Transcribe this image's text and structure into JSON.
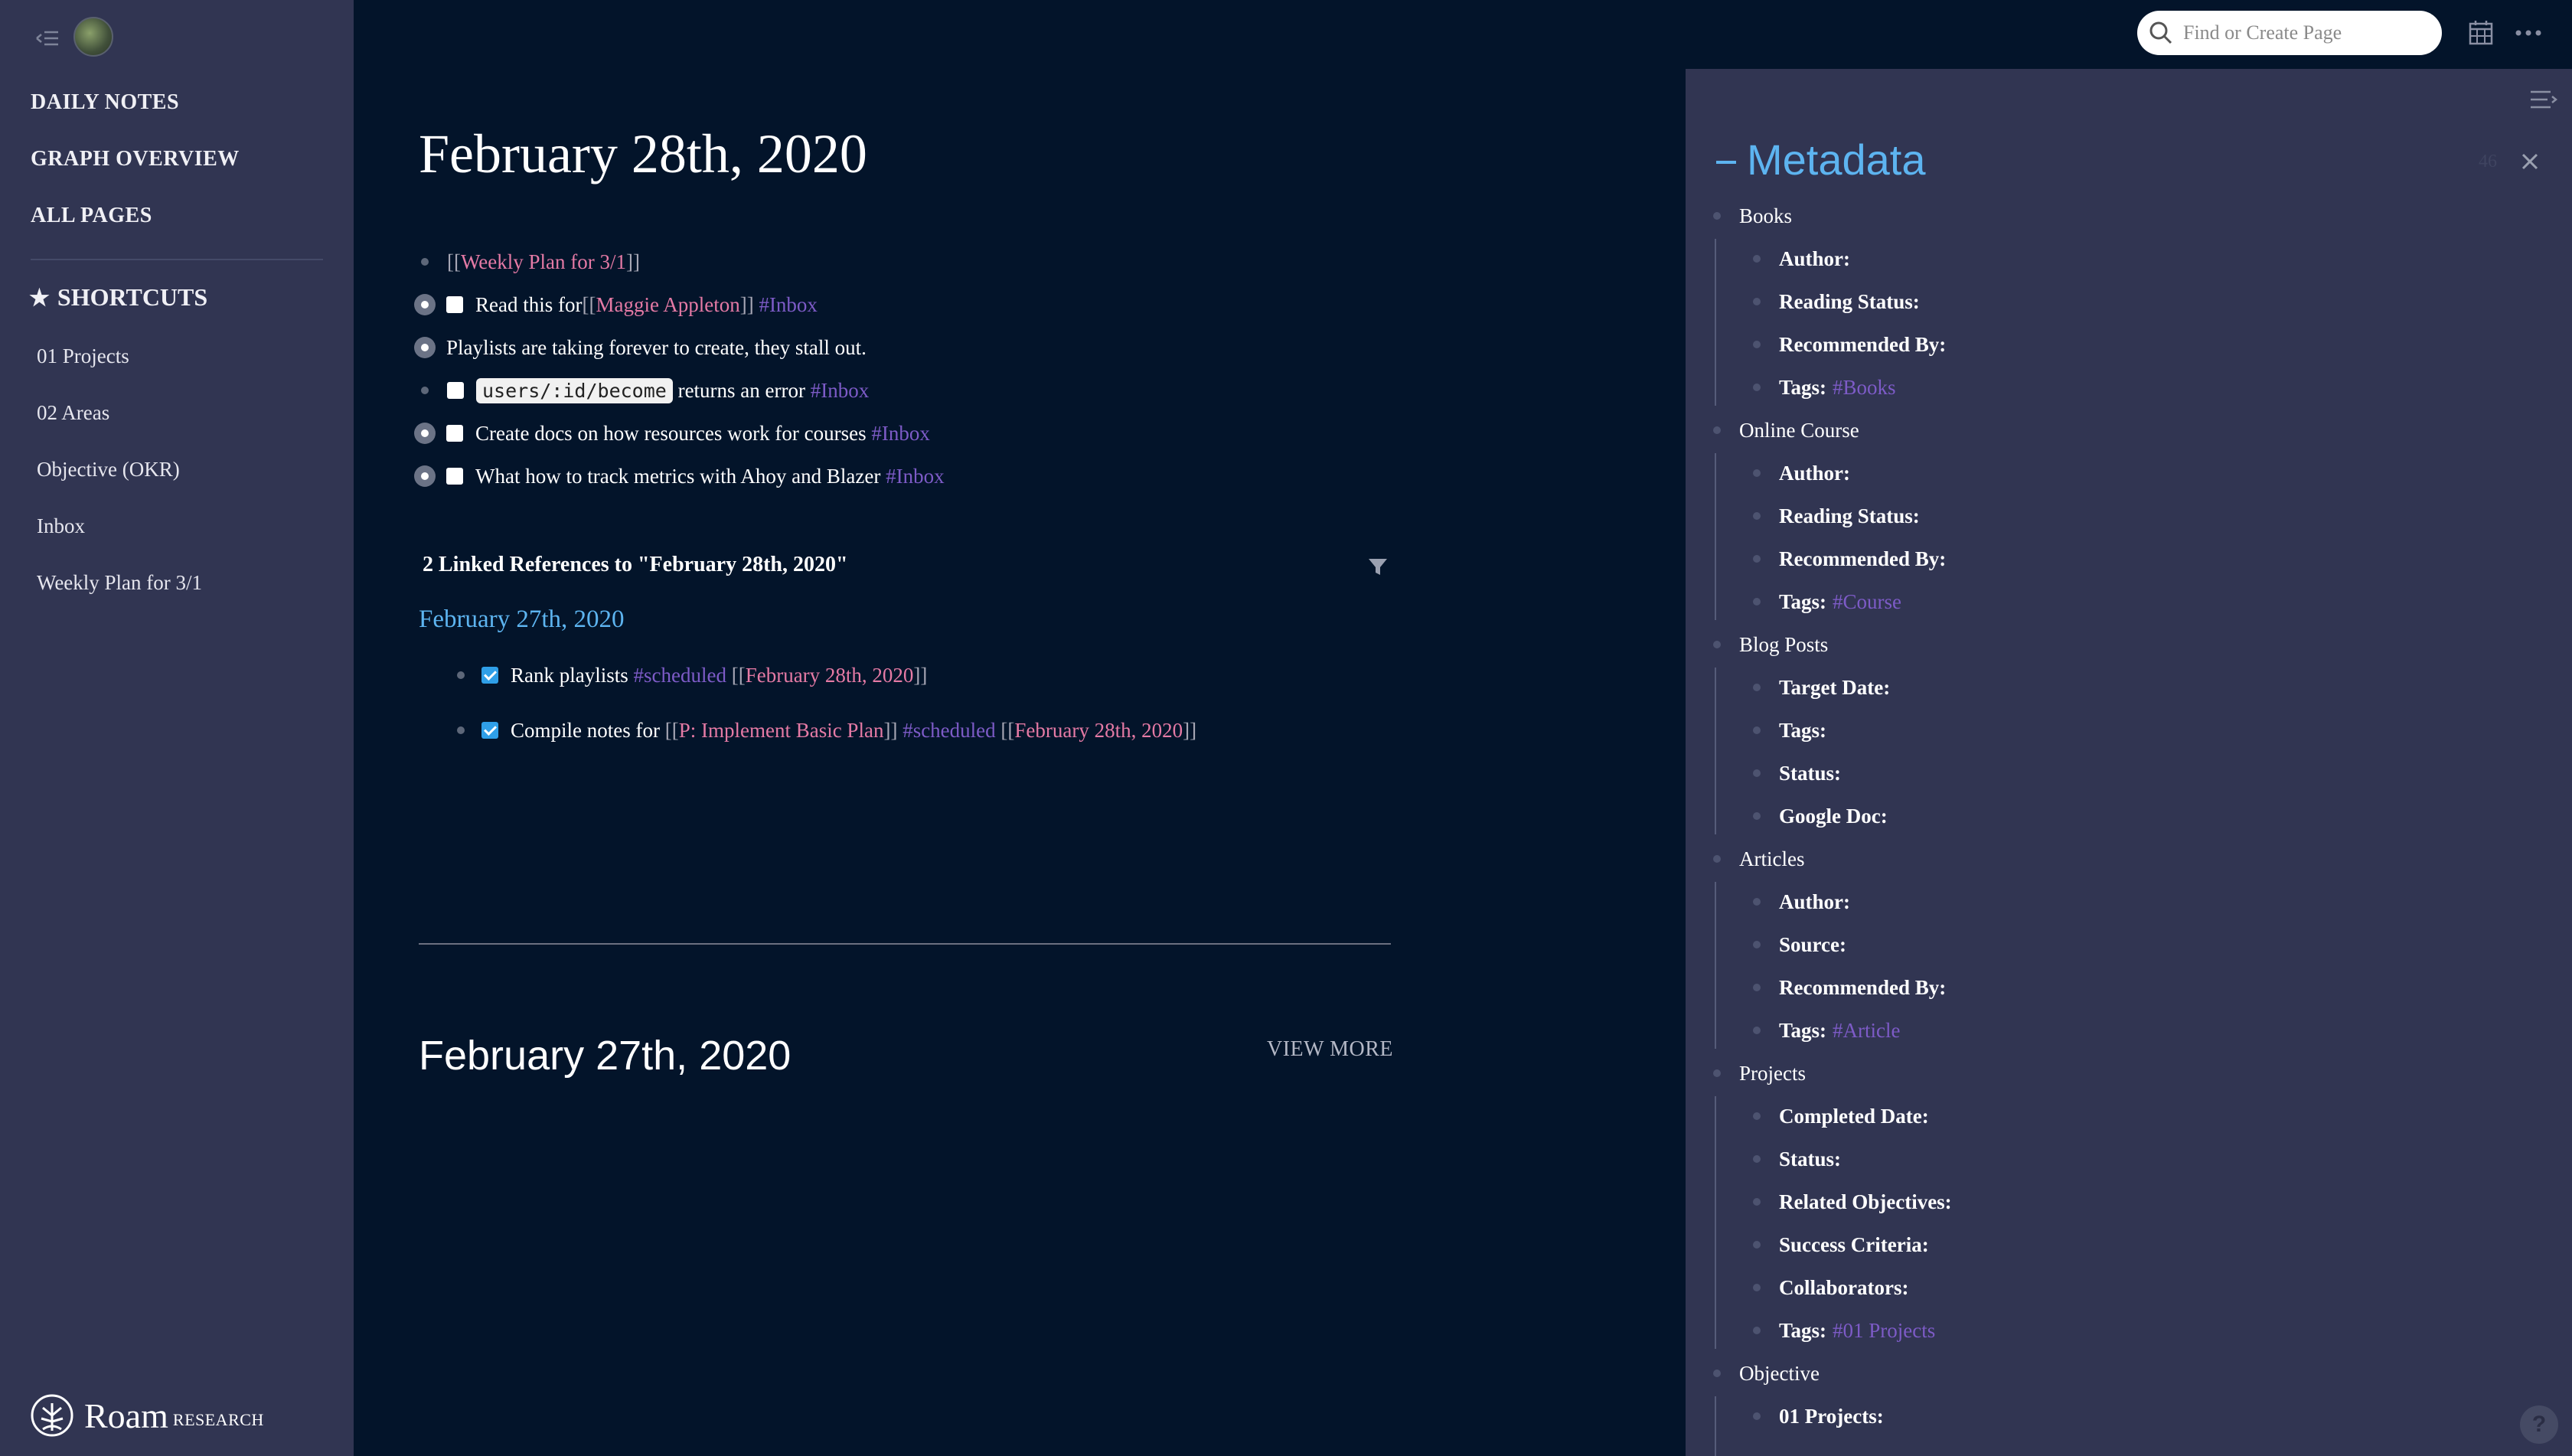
{
  "sidebar": {
    "nav": [
      "DAILY NOTES",
      "GRAPH OVERVIEW",
      "ALL PAGES"
    ],
    "shortcuts_label": "SHORTCUTS",
    "shortcuts": [
      "01 Projects",
      "02 Areas",
      "Objective (OKR)",
      "Inbox",
      "Weekly Plan for 3/1"
    ],
    "logo_word": "Roam",
    "logo_sub": "RESEARCH"
  },
  "topbar": {
    "search_placeholder": "Find or Create Page"
  },
  "main": {
    "title": "February 28th, 2020",
    "blocks": {
      "b1_link": "Weekly Plan for 3/1",
      "b2_text": "Read this for ",
      "b2_link": "Maggie Appleton",
      "b2_tag": "#Inbox",
      "b3_text": "Playlists are taking forever to create, they stall out.",
      "b4_code": "users/:id/become",
      "b4_text": " returns an error ",
      "b4_tag": "#Inbox",
      "b5_text": "Create docs on how resources work for courses ",
      "b5_tag": "#Inbox",
      "b6_text": "What how to track metrics with Ahoy and Blazer ",
      "b6_tag": "#Inbox"
    },
    "linked_refs_heading": "2 Linked References to \"February 28th, 2020\"",
    "ref_page": "February 27th, 2020",
    "refs": {
      "r1_text": "Rank playlists ",
      "r1_tag": "#scheduled",
      "r1_link": "February 28th, 2020",
      "r2_text": "Compile notes for ",
      "r2_link1": "P: Implement Basic Plan",
      "r2_tag": "#scheduled",
      "r2_link2": "February 28th, 2020"
    },
    "second_page_title": "February 27th, 2020",
    "view_more": "VIEW MORE"
  },
  "right_panel": {
    "title": "Metadata",
    "count": "46",
    "sections": [
      {
        "name": "Books",
        "fields": [
          {
            "label": "Author:",
            "tag": ""
          },
          {
            "label": "Reading Status:",
            "tag": ""
          },
          {
            "label": "Recommended By:",
            "tag": ""
          },
          {
            "label": "Tags:",
            "tag": "#Books"
          }
        ]
      },
      {
        "name": "Online Course",
        "fields": [
          {
            "label": "Author:",
            "tag": ""
          },
          {
            "label": "Reading Status:",
            "tag": ""
          },
          {
            "label": "Recommended By:",
            "tag": ""
          },
          {
            "label": "Tags:",
            "tag": "#Course"
          }
        ]
      },
      {
        "name": "Blog Posts",
        "fields": [
          {
            "label": "Target Date:",
            "tag": ""
          },
          {
            "label": "Tags:",
            "tag": ""
          },
          {
            "label": "Status:",
            "tag": ""
          },
          {
            "label": "Google Doc:",
            "tag": ""
          }
        ]
      },
      {
        "name": "Articles",
        "fields": [
          {
            "label": "Author:",
            "tag": ""
          },
          {
            "label": "Source:",
            "tag": ""
          },
          {
            "label": "Recommended By:",
            "tag": ""
          },
          {
            "label": "Tags:",
            "tag": "#Article"
          }
        ]
      },
      {
        "name": "Projects",
        "fields": [
          {
            "label": "Completed Date:",
            "tag": ""
          },
          {
            "label": "Status:",
            "tag": ""
          },
          {
            "label": "Related Objectives:",
            "tag": ""
          },
          {
            "label": "Success Criteria:",
            "tag": ""
          },
          {
            "label": "Collaborators:",
            "tag": ""
          },
          {
            "label": "Tags:",
            "tag": "#01 Projects"
          }
        ]
      },
      {
        "name": "Objective",
        "fields": [
          {
            "label": "01 Projects:",
            "tag": ""
          }
        ]
      }
    ]
  },
  "help_label": "?",
  "colors": {
    "background": "#03142a",
    "sidebar": "#313552",
    "link_pink": "#e57aa5",
    "tag_purple": "#7d5bc7",
    "accent_blue": "#5db4f0"
  }
}
